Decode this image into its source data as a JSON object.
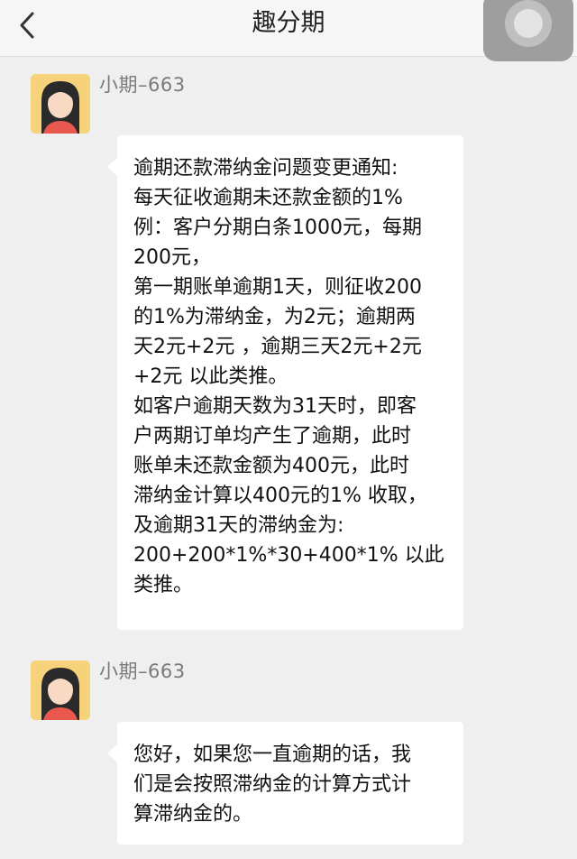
{
  "header": {
    "title": "趣分期",
    "back_icon": "chevron-left-icon"
  },
  "messages": [
    {
      "sender": "小期–663",
      "text": "逾期还款滞纳金问题变更通知:\n每天征收逾期未还款金额的1%\n例：客户分期白条1000元，每期\n200元，\n第一期账单逾期1天，则征收200\n的1%为滞纳金，为2元；逾期两\n天2元+2元 ，逾期三天2元+2元\n+2元 以此类推。\n如客户逾期天数为31天时，即客\n户两期订单均产生了逾期，此时\n账单未还款金额为400元，此时\n滞纳金计算以400元的1% 收取，\n及逾期31天的滞纳金为:\n200+200*1%*30+400*1% 以此\n类推。"
    },
    {
      "sender": "小期–663",
      "text": "您好，如果您一直逾期的话，我\n们是会按照滞纳金的计算方式计\n算滞纳金的。"
    }
  ]
}
